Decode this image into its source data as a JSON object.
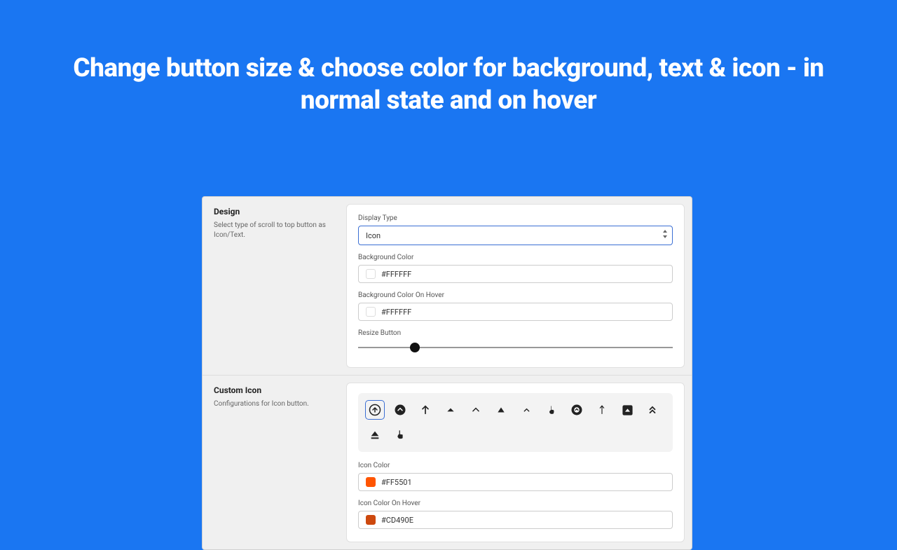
{
  "hero": {
    "title": "Change button size & choose color for background, text & icon - in normal state and on hover"
  },
  "design": {
    "title": "Design",
    "desc": "Select type of scroll to top button as Icon/Text.",
    "displayTypeLabel": "Display Type",
    "displayTypeValue": "Icon",
    "bgColorLabel": "Background Color",
    "bgColorValue": "#FFFFFF",
    "bgHoverLabel": "Background Color On Hover",
    "bgHoverValue": "#FFFFFF",
    "resizeLabel": "Resize Button"
  },
  "customIcon": {
    "title": "Custom Icon",
    "desc": "Configurations for Icon button.",
    "iconColorLabel": "Icon Color",
    "iconColorValue": "#FF5501",
    "iconHoverLabel": "Icon Color On Hover",
    "iconHoverValue": "#CD490E",
    "iconColorSwatch": "#FF5501",
    "iconHoverSwatch": "#CD490E"
  }
}
